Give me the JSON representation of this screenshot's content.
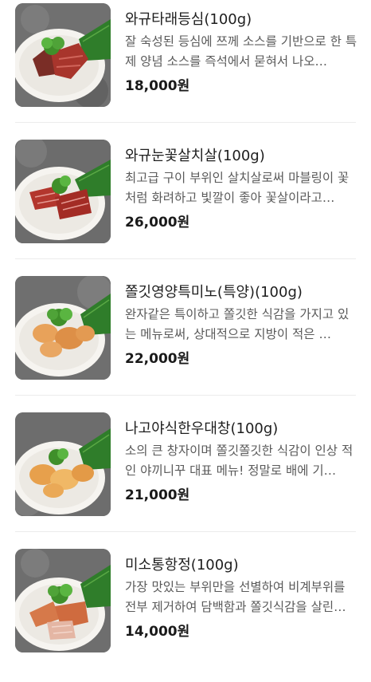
{
  "menu": {
    "items": [
      {
        "name": "와규타래등심(100g)",
        "description": "잘 숙성된 등심에 쯔께 소스를 기반으로 한 특제 양념 소스를 즉석에서 묻혀서 나오…",
        "price": "18,000원",
        "image_icon": "marinated-beef-sirloin-dish"
      },
      {
        "name": "와규눈꽃살치살(100g)",
        "description": "최고급 구이 부위인 살치살로써 마블링이 꽃처럼 화려하고 빛깔이 좋아 꽃살이라고…",
        "price": "26,000원",
        "image_icon": "marbled-chuck-flap-dish"
      },
      {
        "name": "쫄깃영양특미노(특양)(100g)",
        "description": "완자같은 특이하고 쫄깃한 식감을 가지고 있는 메뉴로써, 상대적으로 지방이 적은 …",
        "price": "22,000원",
        "image_icon": "tripe-dish"
      },
      {
        "name": "나고야식한우대창(100g)",
        "description": "소의 큰 창자이며 쫄깃쫄깃한 식감이 인상 적인 야끼니꾸 대표 메뉴! 정말로 배에 기…",
        "price": "21,000원",
        "image_icon": "beef-large-intestine-dish"
      },
      {
        "name": "미소통항정(100g)",
        "description": "가장 맛있는 부위만을 선별하여 비계부위를 전부 제거하여 담백함과 쫄깃식감을 살린…",
        "price": "14,000원",
        "image_icon": "miso-pork-jowl-dish"
      }
    ]
  },
  "colors": {
    "background": "#ffffff",
    "name_text": "#1e1e1e",
    "description_text": "#5a5a5a",
    "price_text": "#1a1a1a",
    "divider": "#ececec",
    "plate": "#f7f5f1",
    "garnish": "#3f8f2a",
    "leaf": "#2f7d2a",
    "slate": "#6e6e6e"
  }
}
